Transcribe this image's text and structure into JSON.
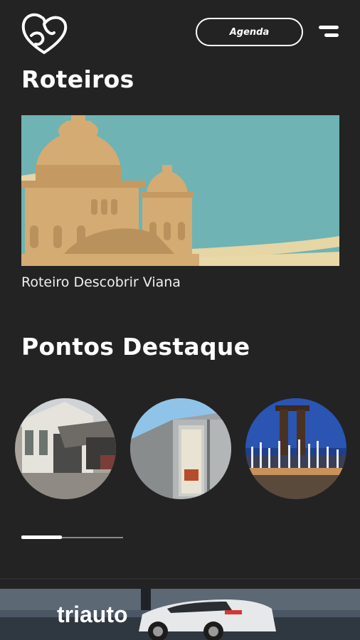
{
  "header": {
    "logo_icon": "heart-logo-icon",
    "agenda_label": "Agenda",
    "menu_icon": "menu-icon"
  },
  "roteiros": {
    "title": "Roteiros",
    "items": [
      {
        "label": "Roteiro Descobrir Viana"
      }
    ]
  },
  "pontos_destaque": {
    "title": "Pontos Destaque",
    "items": [
      {
        "image": "station-building-photo"
      },
      {
        "image": "concrete-pavilion-photo"
      },
      {
        "image": "fountain-monument-photo"
      }
    ],
    "scroll_position": 0.4
  },
  "ad_banner": {
    "brand": "triauto"
  },
  "colors": {
    "background": "#232323",
    "text": "#ffffff",
    "illustration_sky": "#6fb3b4",
    "illustration_building": "#d4ab72"
  }
}
